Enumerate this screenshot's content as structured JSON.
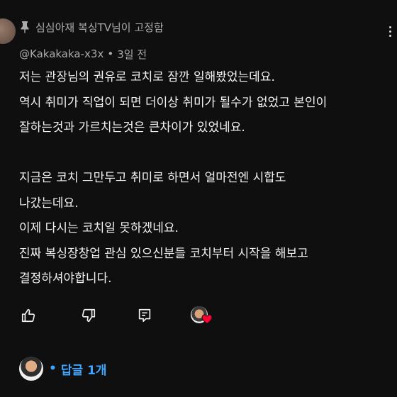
{
  "pinned": {
    "icon": "pin-icon",
    "text": "심심아재 복싱TV님이 고정함"
  },
  "comment": {
    "author": "@Kakakaka-x3x",
    "separator": "•",
    "time": "3일 전",
    "lines": [
      "저는 관장님의 권유로 코치로 잠깐 일해봤었는데요.",
      "역시 취미가 직업이 되면 더이상 취미가 될수가 없었고 본인이",
      "잘하는것과 가르치는것은 큰차이가 있었네요.",
      "",
      "지금은 코치 그만두고 취미로 하면서 얼마전엔 시합도",
      "나갔는데요.",
      "이제 다시는 코치일 못하겠네요.",
      "진짜 복싱장창업 관심 있으신분들 코치부터 시작을 해보고",
      "결정하셔야합니다."
    ]
  },
  "actions": {
    "like_icon": "thumbs-up-icon",
    "dislike_icon": "thumbs-down-icon",
    "reply_icon": "reply-icon",
    "creator_heart_icon": "creator-heart-icon"
  },
  "replies": {
    "bullet": "•",
    "label": "답글 1개"
  },
  "colors": {
    "background": "#0f0f0f",
    "text": "#f1f1f1",
    "muted": "#aaaaaa",
    "link": "#3ea6ff",
    "heart": "#ff0033"
  }
}
